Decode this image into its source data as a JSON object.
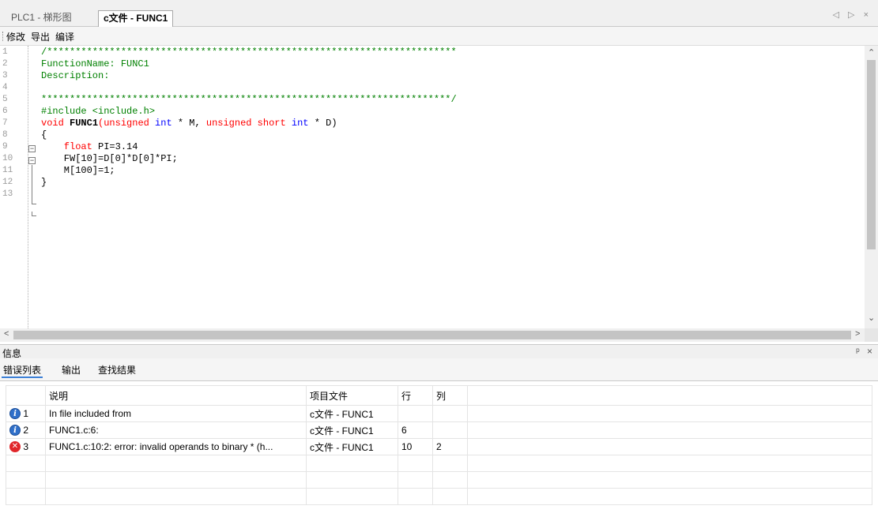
{
  "tabs": [
    {
      "label": "PLC1 - 梯形图",
      "active": false
    },
    {
      "label": "c文件 - FUNC1",
      "active": true
    }
  ],
  "tab_nav": "◁ ▷ ×",
  "menu": [
    "修改",
    "导出",
    "编译"
  ],
  "editor": {
    "line_numbers": [
      "1",
      "2",
      "3",
      "4",
      "5",
      "6",
      "7",
      "8",
      "9",
      "10",
      "11",
      "12",
      "13"
    ],
    "lines": [
      [
        {
          "t": "/************************************************************************",
          "c": "comment"
        }
      ],
      [
        {
          "t": "FunctionName: FUNC1",
          "c": "comment"
        }
      ],
      [
        {
          "t": "Description:",
          "c": "comment"
        }
      ],
      [],
      [
        {
          "t": "************************************************************************/",
          "c": "comment"
        }
      ],
      [
        {
          "t": "#include <include.h>",
          "c": "comment"
        }
      ],
      [
        {
          "t": "void ",
          "c": "keyword"
        },
        {
          "t": "FUNC1",
          "c": "bold"
        },
        {
          "t": "(",
          "c": "keyword"
        },
        {
          "t": "unsigned ",
          "c": "keyword"
        },
        {
          "t": "int",
          "c": "blue"
        },
        {
          "t": " * M, ",
          "c": "black"
        },
        {
          "t": "unsigned short ",
          "c": "keyword"
        },
        {
          "t": "int",
          "c": "blue"
        },
        {
          "t": " * D)",
          "c": "black"
        }
      ],
      [
        {
          "t": "{",
          "c": "black"
        }
      ],
      [
        {
          "t": "    float ",
          "c": "keyword"
        },
        {
          "t": "PI=3.14",
          "c": "black"
        }
      ],
      [
        {
          "t": "    FW[10]=D[0]*D[0]*PI;",
          "c": "black"
        }
      ],
      [
        {
          "t": "    M[100]=1;",
          "c": "black"
        }
      ],
      [
        {
          "t": "}",
          "c": "black"
        }
      ],
      []
    ]
  },
  "info_panel": {
    "title": "信息",
    "controls": "ᵖ ×",
    "tabs": [
      "错误列表",
      "输出",
      "查找结果"
    ],
    "columns": [
      "",
      "说明",
      "项目文件",
      "行",
      "列"
    ],
    "rows": [
      {
        "icon": "info-icon",
        "num": "1",
        "desc": "In file included from",
        "file": "c文件 - FUNC1",
        "line": "",
        "col": ""
      },
      {
        "icon": "info-icon",
        "num": "2",
        "desc": "FUNC1.c:6:",
        "file": "c文件 - FUNC1",
        "line": "6",
        "col": ""
      },
      {
        "icon": "error-icon",
        "num": "3",
        "desc": "FUNC1.c:10:2: error: invalid operands to binary * (h...",
        "file": "c文件 - FUNC1",
        "line": "10",
        "col": "2"
      }
    ]
  },
  "colors": {
    "comment": "#008000",
    "keyword": "#ff0000",
    "type": "#0000ff",
    "info_icon": "#2f6fc9",
    "error_icon": "#e0262a"
  }
}
